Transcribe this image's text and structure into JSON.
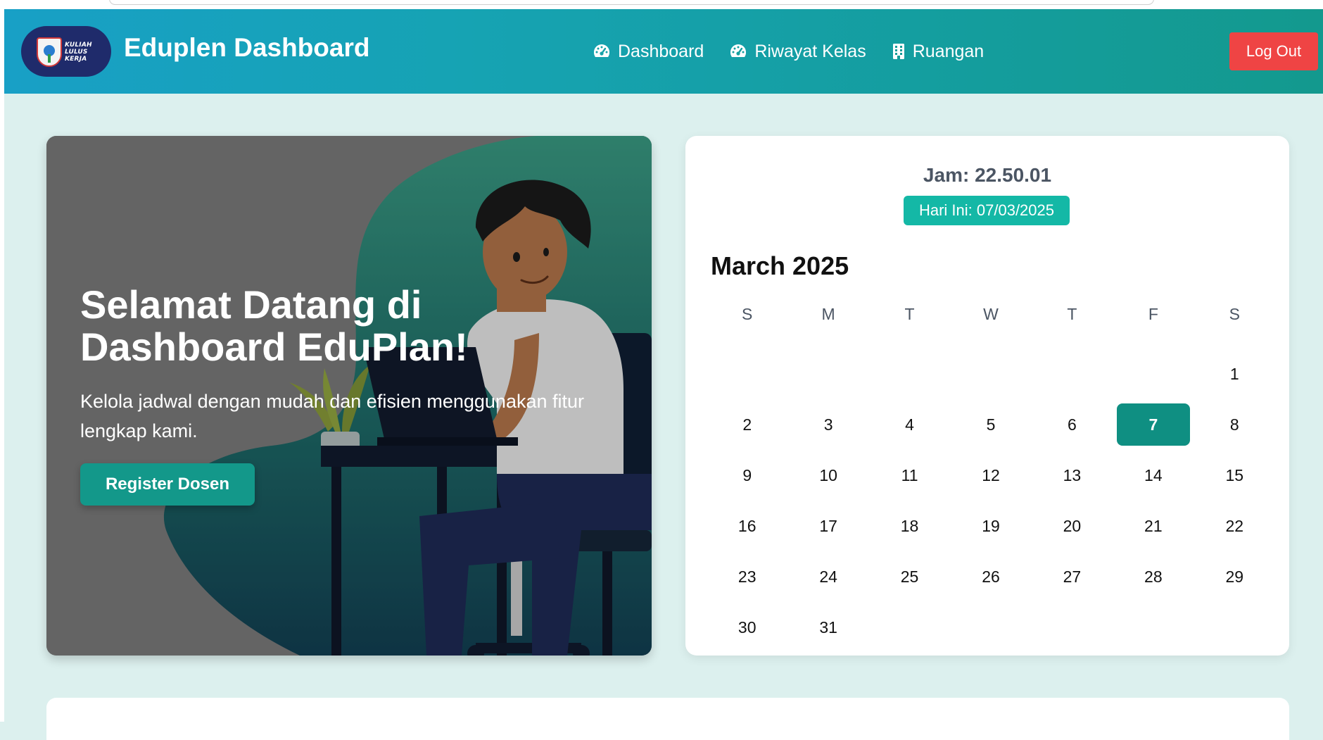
{
  "header": {
    "logo_text": "KULIAH LULUS KERJA",
    "title": "Eduplen Dashboard",
    "nav": [
      {
        "label": "Dashboard",
        "icon": "gauge-icon"
      },
      {
        "label": "Riwayat Kelas",
        "icon": "gauge-icon"
      },
      {
        "label": "Ruangan",
        "icon": "building-icon"
      }
    ],
    "logout_label": "Log Out"
  },
  "hero": {
    "title": "Selamat Datang di Dashboard EduPlan!",
    "subtitle": "Kelola jadwal dengan mudah dan efisien menggunakan fitur lengkap kami.",
    "button_label": "Register Dosen"
  },
  "calendar": {
    "clock": "Jam: 22.50.01",
    "today_badge": "Hari Ini: 07/03/2025",
    "month_title": "March 2025",
    "weekdays": [
      "S",
      "M",
      "T",
      "W",
      "T",
      "F",
      "S"
    ],
    "leading_blanks": 6,
    "days": [
      "1",
      "2",
      "3",
      "4",
      "5",
      "6",
      "7",
      "8",
      "9",
      "10",
      "11",
      "12",
      "13",
      "14",
      "15",
      "16",
      "17",
      "18",
      "19",
      "20",
      "21",
      "22",
      "23",
      "24",
      "25",
      "26",
      "27",
      "28",
      "29",
      "30",
      "31"
    ],
    "selected_day": "7"
  },
  "colors": {
    "header_start": "#18a0c6",
    "header_end": "#13998e",
    "logout": "#ef4444",
    "accent": "#13988a",
    "badge": "#14b8a6",
    "page_bg": "#dcf0ee"
  }
}
